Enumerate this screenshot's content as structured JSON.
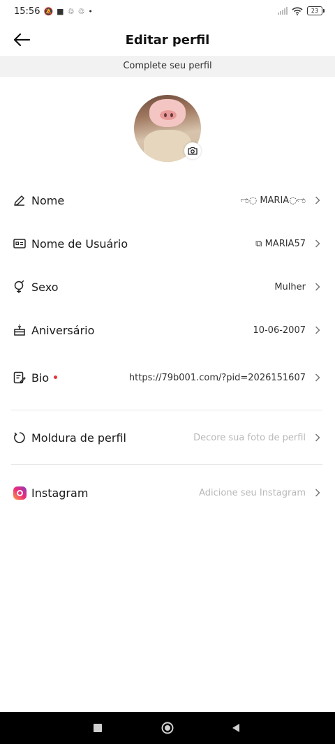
{
  "status_bar": {
    "time": "15:56",
    "battery": "23",
    "icons": [
      "mute-icon",
      "video-icon",
      "sync-icon",
      "sync-icon",
      "dot-icon",
      "signal-icon",
      "wifi-icon",
      "battery-icon"
    ]
  },
  "header": {
    "title": "Editar perfil",
    "back_icon": "arrow-left-icon"
  },
  "banner": {
    "text": "Complete seu perfil"
  },
  "avatar": {
    "camera_icon": "camera-icon"
  },
  "rows": [
    {
      "icon": "pencil-icon",
      "label": "Nome",
      "value": "ಌ◌ MARIA◌ಌ"
    },
    {
      "icon": "id-card-icon",
      "label": "Nome de Usuário",
      "value": "⧉ MARIA57"
    },
    {
      "icon": "gender-icon",
      "label": "Sexo",
      "value": "Mulher"
    },
    {
      "icon": "cake-icon",
      "label": "Aniversário",
      "value": "10-06-2007"
    },
    {
      "icon": "edit-note-icon",
      "label": "Bio",
      "value": "https://79b001.com/?pid=2026151607"
    },
    {
      "icon": "refresh-icon",
      "label": "Moldura de perfil",
      "value": "Decore sua foto de perfil"
    },
    {
      "icon": "instagram-icon",
      "label": "Instagram",
      "value": "Adicione seu Instagram"
    }
  ],
  "colors": {
    "banner_bg": "#f2f2f2",
    "placeholder": "#b8b8b8",
    "red_dot": "#e8323c",
    "nav_bar": "#000000"
  },
  "nav": {
    "icons": [
      "square-icon",
      "circle-icon",
      "triangle-back-icon"
    ]
  }
}
